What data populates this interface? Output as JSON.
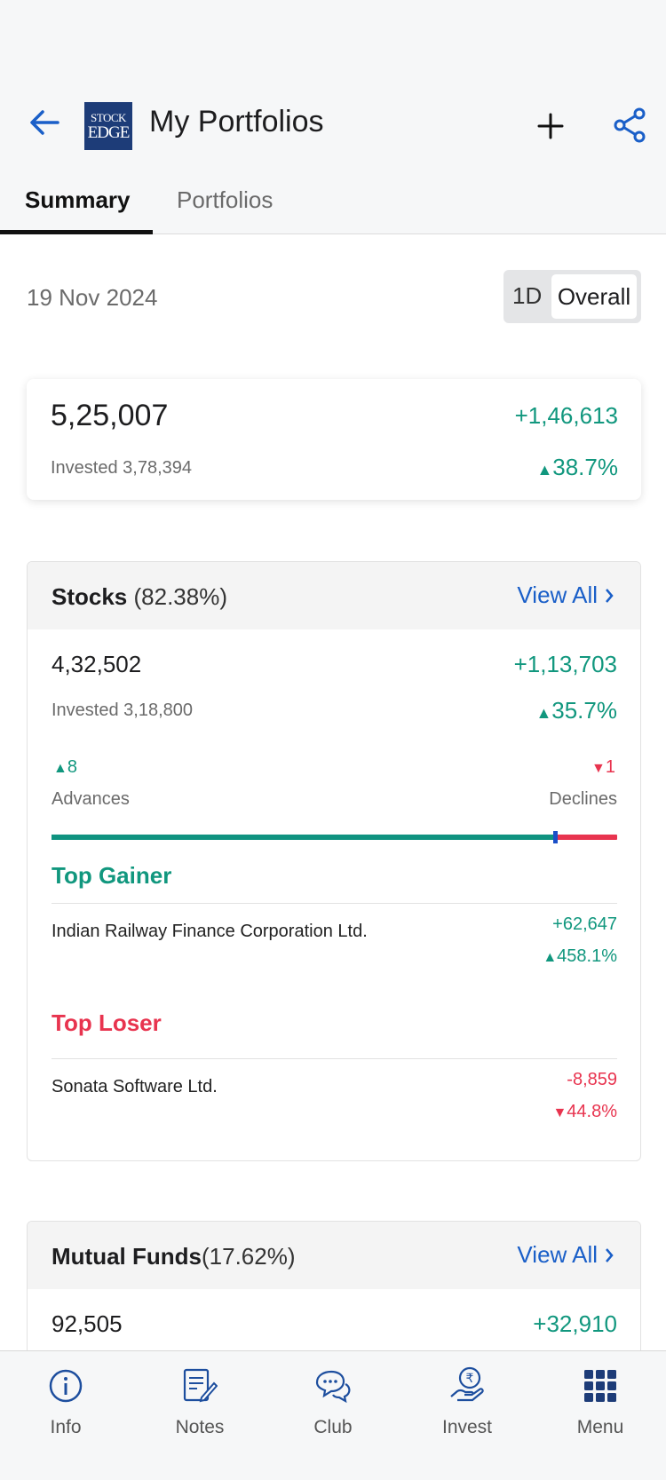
{
  "header": {
    "title": "My Portfolios",
    "logo_line1": "STOCK",
    "logo_line2": "EDGE"
  },
  "tabs": [
    {
      "label": "Summary",
      "active": true
    },
    {
      "label": "Portfolios",
      "active": false
    }
  ],
  "summary": {
    "date": "19 Nov 2024",
    "toggle_options": [
      "1D",
      "Overall"
    ],
    "selected_toggle": "Overall",
    "current_value": "5,25,007",
    "gain": "+1,46,613",
    "invested_label": "Invested 3,78,394",
    "gain_pct": "38.7%"
  },
  "stocks": {
    "title": "Stocks",
    "share": "(82.38%)",
    "view_all": "View All",
    "current_value": "4,32,502",
    "gain": "+1,13,703",
    "invested_label": "Invested 3,18,800",
    "gain_pct": "35.7%",
    "advances_count": "8",
    "declines_count": "1",
    "advances_label": "Advances",
    "declines_label": "Declines",
    "advances_fraction": 0.89,
    "top_gainer": {
      "heading": "Top Gainer",
      "name": "Indian Railway Finance Corporation Ltd.",
      "change": "+62,647",
      "pct": "458.1%"
    },
    "top_loser": {
      "heading": "Top Loser",
      "name": "Sonata Software Ltd.",
      "change": "-8,859",
      "pct": "44.8%"
    }
  },
  "mutual_funds": {
    "title": "Mutual Funds",
    "share": "(17.62%)",
    "view_all": "View All",
    "current_value": "92,505",
    "gain": "+32,910"
  },
  "bottom_nav": [
    {
      "label": "Info",
      "icon": "info-icon"
    },
    {
      "label": "Notes",
      "icon": "notes-icon"
    },
    {
      "label": "Club",
      "icon": "chat-icon"
    },
    {
      "label": "Invest",
      "icon": "rupee-hand-icon"
    },
    {
      "label": "Menu",
      "icon": "grid-menu-icon"
    }
  ],
  "colors": {
    "positive": "#11977e",
    "negative": "#e8344f",
    "accent": "#1a5fc8",
    "brand": "#1d3c78"
  }
}
